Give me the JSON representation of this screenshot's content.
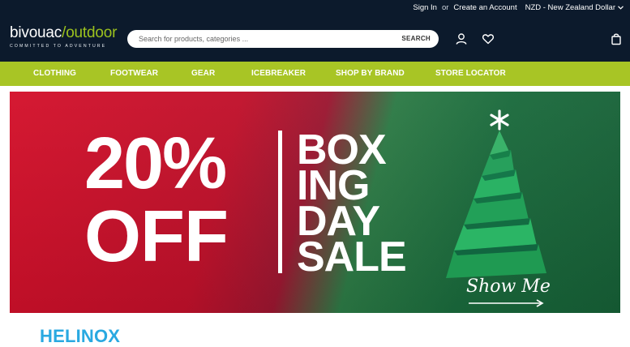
{
  "topbar": {
    "sign_in": "Sign In",
    "or": "or",
    "create_account": "Create an Account",
    "currency": "NZD - New Zealand Dollar"
  },
  "logo": {
    "brand_a": "bivouac",
    "slash": "/",
    "brand_b": "outdoor",
    "tagline": "COMMITTED TO ADVENTURE"
  },
  "search": {
    "placeholder": "Search for products, categories ...",
    "button": "SEARCH"
  },
  "icons": {
    "account": "user-icon",
    "wishlist": "heart-icon",
    "cart": "shopping-bag-icon",
    "currency_caret": "chevron-down-icon"
  },
  "nav": {
    "items": [
      "CLOTHING",
      "FOOTWEAR",
      "GEAR",
      "ICEBREAKER",
      "SHOP BY BRAND",
      "STORE LOCATOR"
    ]
  },
  "banner": {
    "percent": "20%",
    "off": "OFF",
    "line1": "BOX",
    "line2": "ING",
    "line3": "DAY",
    "line4": "SALE",
    "cta": "Show Me"
  },
  "section": {
    "brand_heading": "HELINOX"
  },
  "colors": {
    "header_bg": "#0c1a2c",
    "nav_bg": "#a8c525",
    "banner_red": "#d4102a",
    "banner_green": "#1a6a3c",
    "brand_blue": "#29a9e1"
  }
}
